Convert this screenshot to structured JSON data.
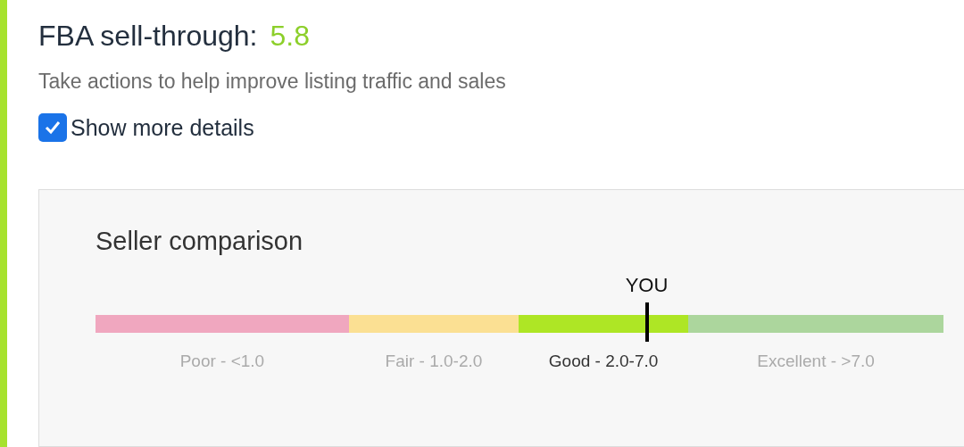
{
  "metric": {
    "label": "FBA sell-through:",
    "value": "5.8"
  },
  "subtitle": "Take actions to help improve listing traffic and sales",
  "details_checkbox": {
    "label": "Show more details",
    "checked": true
  },
  "comparison": {
    "title": "Seller comparison",
    "marker_label": "YOU",
    "level": 0.65,
    "segments": [
      {
        "label": "Poor - <1.0",
        "color": "#f0a7bf",
        "selected": false
      },
      {
        "label": "Fair - 1.0-2.0",
        "color": "#fbe093",
        "selected": false
      },
      {
        "label": "Good - 2.0-7.0",
        "color": "#aee625",
        "selected": true
      },
      {
        "label": "Excellent - >7.0",
        "color": "#acd69d",
        "selected": false
      }
    ]
  }
}
